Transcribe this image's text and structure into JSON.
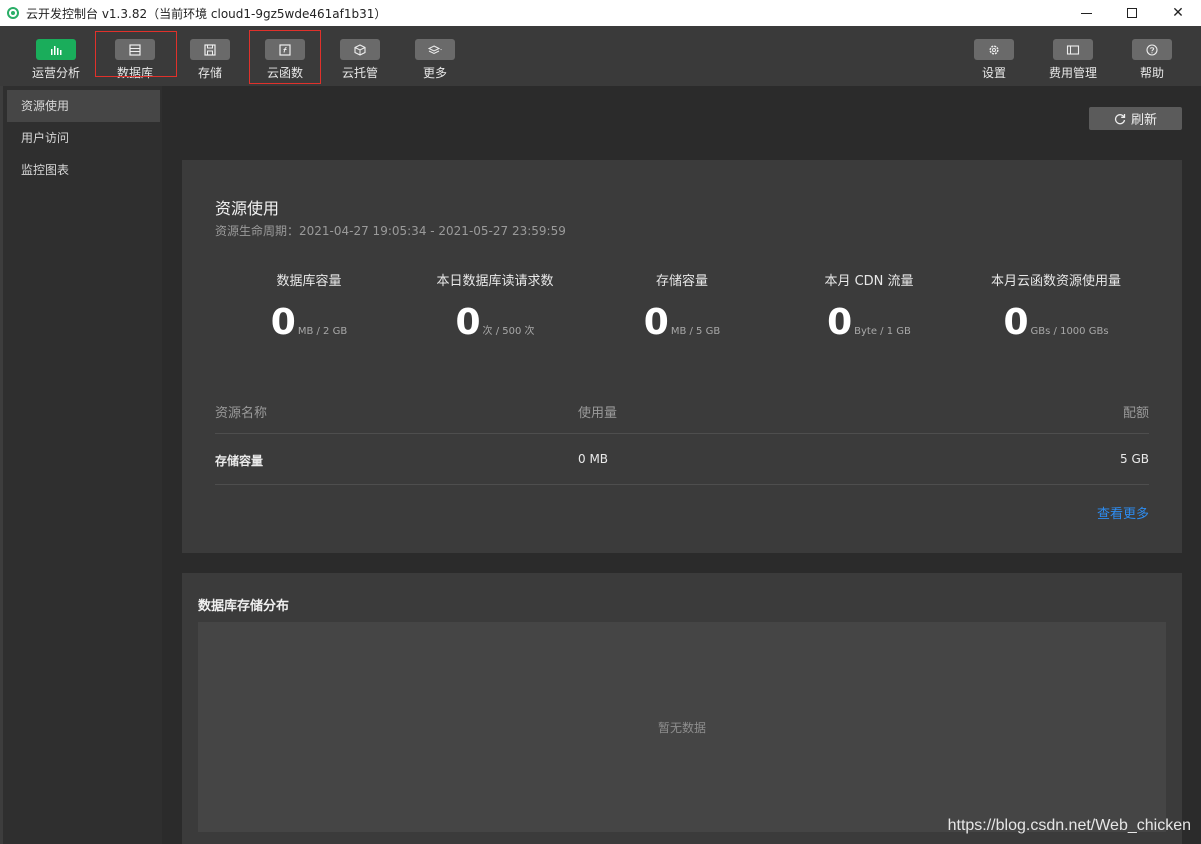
{
  "window": {
    "title": "云开发控制台 v1.3.82（当前环境 cloud1-9gz5wde461af1b31）",
    "close_glyph": "✕"
  },
  "toolbar": {
    "items": [
      {
        "label": "运营分析",
        "icon": "bar-chart-icon"
      },
      {
        "label": "数据库",
        "icon": "database-icon"
      },
      {
        "label": "存储",
        "icon": "save-icon"
      },
      {
        "label": "云函数",
        "icon": "function-icon"
      },
      {
        "label": "云托管",
        "icon": "cube-icon"
      },
      {
        "label": "更多",
        "icon": "layers-icon"
      },
      {
        "label": "设置",
        "icon": "gear-icon"
      },
      {
        "label": "费用管理",
        "icon": "billing-icon"
      },
      {
        "label": "帮助",
        "icon": "help-icon"
      }
    ],
    "active_color": "#1aad5b",
    "highlight_color": "#e0312b"
  },
  "sidebar": {
    "items": [
      {
        "label": "资源使用"
      },
      {
        "label": "用户访问"
      },
      {
        "label": "监控图表"
      }
    ]
  },
  "main": {
    "refresh_label": "刷新",
    "card": {
      "title": "资源使用",
      "period": "资源生命周期：2021-04-27 19:05:34 - 2021-05-27 23:59:59",
      "metrics": [
        {
          "label": "数据库容量",
          "value": "0",
          "unit": "MB / 2 GB"
        },
        {
          "label": "本日数据库读请求数",
          "value": "0",
          "unit": "次 / 500 次"
        },
        {
          "label": "存储容量",
          "value": "0",
          "unit": "MB / 5 GB"
        },
        {
          "label": "本月 CDN 流量",
          "value": "0",
          "unit": "Byte / 1 GB"
        },
        {
          "label": "本月云函数资源使用量",
          "value": "0",
          "unit": "GBs / 1000 GBs"
        }
      ],
      "table": {
        "headers": [
          "资源名称",
          "使用量",
          "配额"
        ],
        "rows": [
          {
            "name": "存储容量",
            "usage": "0 MB",
            "quota": "5 GB"
          }
        ]
      },
      "more_link": "查看更多"
    },
    "distribution": {
      "title": "数据库存储分布",
      "empty_text": "暂无数据"
    }
  },
  "watermark": "https://blog.csdn.net/Web_chicken"
}
